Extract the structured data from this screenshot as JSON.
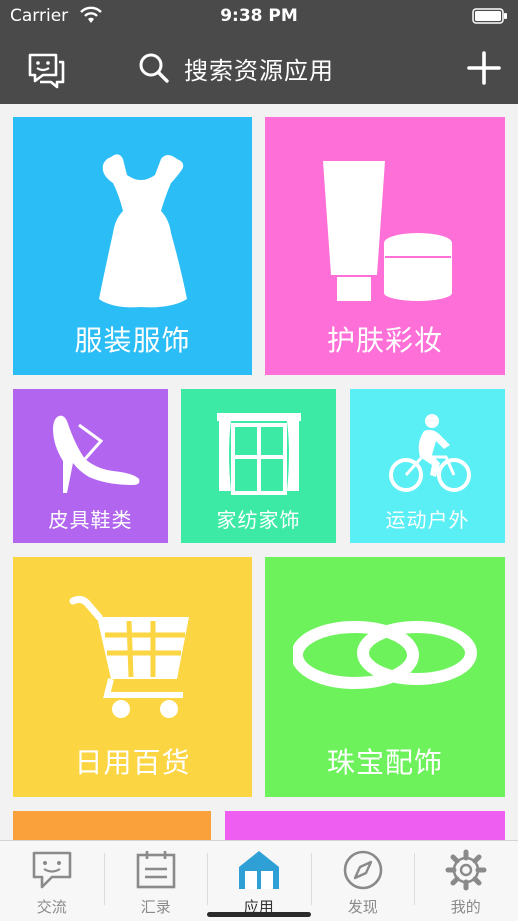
{
  "status_bar": {
    "carrier": "Carrier",
    "time": "9:38 PM"
  },
  "nav": {
    "search_placeholder": "搜索资源应用",
    "icons": [
      "chat-face-icon",
      "search-icon",
      "plus-icon"
    ]
  },
  "categories": [
    {
      "label": "服装服饰",
      "color": "#2bbdf5",
      "icon": "dress-icon"
    },
    {
      "label": "护肤彩妆",
      "color": "#ff6fd8",
      "icon": "cosmetics-icon"
    },
    {
      "label": "皮具鞋类",
      "color": "#b266f0",
      "icon": "high-heel-icon"
    },
    {
      "label": "家纺家饰",
      "color": "#3ceaa6",
      "icon": "curtain-window-icon"
    },
    {
      "label": "运动户外",
      "color": "#5aeef5",
      "icon": "cyclist-icon"
    },
    {
      "label": "日用百货",
      "color": "#fbd542",
      "icon": "shopping-cart-icon"
    },
    {
      "label": "珠宝配饰",
      "color": "#6ef25c",
      "icon": "rings-icon"
    },
    {
      "label": "",
      "color": "#fba13c",
      "icon": ""
    },
    {
      "label": "",
      "color": "#ee5ef0",
      "icon": ""
    }
  ],
  "tabs": [
    {
      "label": "交流",
      "icon": "chat-bubble-icon",
      "active": false
    },
    {
      "label": "汇录",
      "icon": "calendar-icon",
      "active": false
    },
    {
      "label": "应用",
      "icon": "house-icon",
      "active": true
    },
    {
      "label": "发现",
      "icon": "compass-icon",
      "active": false
    },
    {
      "label": "我的",
      "icon": "gear-icon",
      "active": false
    }
  ]
}
